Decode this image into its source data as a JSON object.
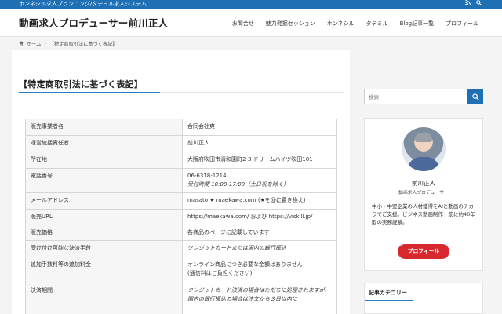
{
  "topbar": {
    "tagline": "ホンネシル求人ブランニング/タテミル求人システム",
    "icons": [
      "rss-icon",
      "search-icon"
    ]
  },
  "header": {
    "site_title": "動画求人プロデューサー前川正人",
    "nav": [
      "お問合せ",
      "魅力発掘セッション",
      "ホンネシル",
      "タテミル",
      "Blog記事一覧",
      "プロフィール"
    ]
  },
  "breadcrumb": {
    "home": "ホーム",
    "current": "【特定商取引法に基づく表記】"
  },
  "page": {
    "title": "【特定商取引法に基づく表記】"
  },
  "table": [
    {
      "key": "販売事業者名",
      "value": "合同会社爽"
    },
    {
      "key": "運営統括責任者",
      "value": "前川正人"
    },
    {
      "key": "所在地",
      "value": "大阪府吹田市清和園町2-3 ドリームハイツ吹田101"
    },
    {
      "key": "電話番号",
      "value": "06-6318-1214",
      "value_italic": "受付時間 10:00-17:00（土日祝を除く）"
    },
    {
      "key": "メールアドレス",
      "value": "masato ★ maekawa.com (★を@に置き換え)"
    },
    {
      "key": "販売URL",
      "value": "https://maekawa.com/ および https://viskill.jp/"
    },
    {
      "key": "販売価格",
      "value": "各商品のページに記載しています"
    },
    {
      "key": "受け付け可能な決済手段",
      "value_italic": "クレジットカードまたは国内の銀行振込"
    },
    {
      "key": "追加手数料等の追加料金",
      "value": "オンライン商品につき必要な金額はありません",
      "value2": "(通信料はご負担ください)"
    },
    {
      "key": "決済期間",
      "value_italic": "クレジットカード決済の場合はただちに処理されますが、国内の銀行振込の場合は注文から３日以内に"
    }
  ],
  "sidebar": {
    "search_placeholder": "検索",
    "profile": {
      "name": "前川正人",
      "role": "動画求人プロデューサー",
      "desc": "中小・中堅企業の人材獲得をAIと動画のチカラでご支援。ビジネス動画制作一筋に約40年間の実務経験。",
      "button": "プロフィール"
    },
    "category_title": "記事カテゴリー"
  },
  "colors": {
    "topbar": "#1f6fb5",
    "accent": "#2b78c4",
    "button": "#d7282d"
  }
}
